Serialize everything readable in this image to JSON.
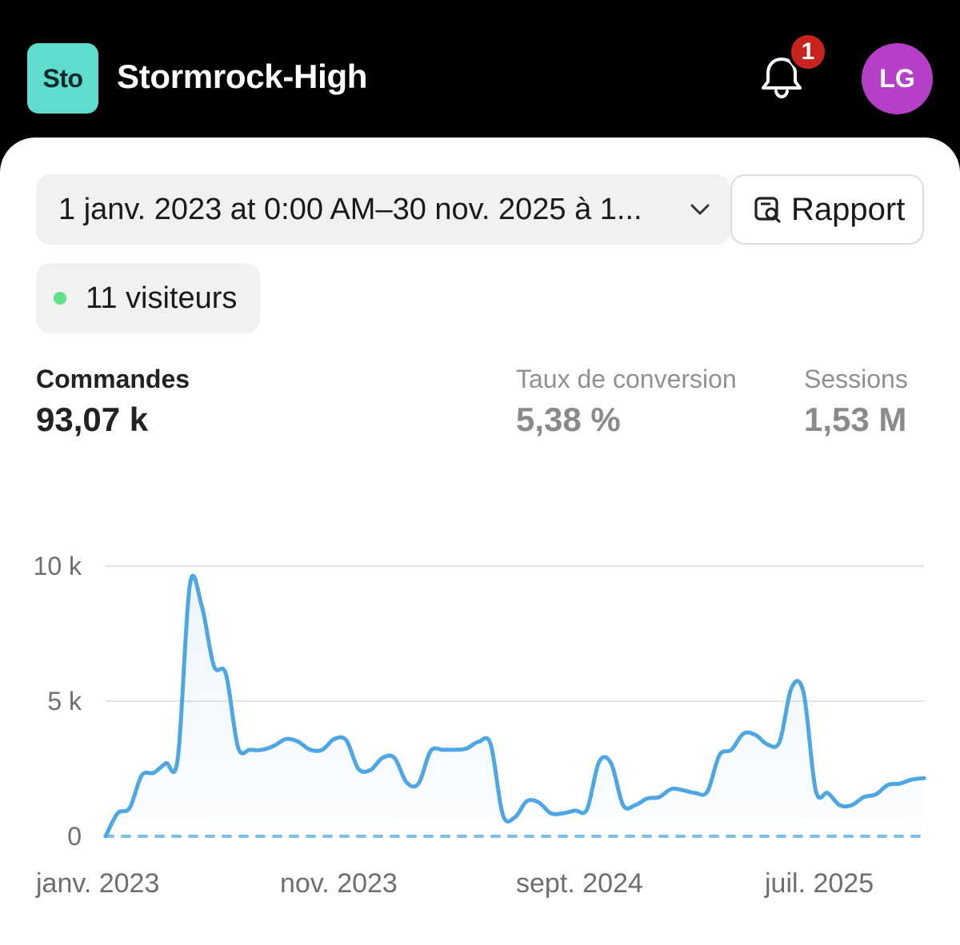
{
  "header": {
    "store_initials": "Sto",
    "store_name": "Stormrock-High",
    "notification_count": "1",
    "user_initials": "LG",
    "colors": {
      "store_logo": "#5fdccd",
      "avatar": "#b63fc8",
      "badge": "#c9231f"
    }
  },
  "filters": {
    "date_range": "1 janv. 2023 at 0:00 AM–30 nov. 2025 à 1...",
    "report_label": "Rapport",
    "live_visitors": "11 visiteurs"
  },
  "metrics": [
    {
      "label": "Commandes",
      "value": "93,07 k",
      "active": true
    },
    {
      "label": "Taux de conversion",
      "value": "5,38 %",
      "active": false
    },
    {
      "label": "Sessions",
      "value": "1,53 M",
      "active": false
    }
  ],
  "chart_data": {
    "type": "line",
    "y_tick_labels": [
      "10 k",
      "5 k",
      "0"
    ],
    "y_ticks": [
      10000,
      5000,
      0
    ],
    "x_tick_labels": [
      "janv. 2023",
      "nov. 2023",
      "sept. 2024",
      "juil. 2025"
    ],
    "ylim": [
      0,
      10000
    ],
    "grid": true,
    "line_color": "#4ea7e3",
    "comparison_line_color": "#7fbfe6",
    "series": [
      {
        "values": [
          0,
          850,
          1050,
          2250,
          2350,
          2700,
          2900,
          9300,
          8500,
          6300,
          6000,
          3300,
          3200,
          3200,
          3350,
          3600,
          3500,
          3200,
          3200,
          3600,
          3550,
          2500,
          2450,
          2900,
          2900,
          2000,
          1950,
          3150,
          3200,
          3200,
          3250,
          3500,
          3400,
          800,
          700,
          1300,
          1250,
          850,
          850,
          950,
          1000,
          2750,
          2700,
          1150,
          1150,
          1400,
          1450,
          1750,
          1700,
          1600,
          1650,
          3000,
          3200,
          3800,
          3750,
          3400,
          3500,
          5500,
          5300,
          1700,
          1600,
          1150,
          1150,
          1450,
          1550,
          1900,
          1950,
          2100,
          2150
        ]
      },
      {
        "values": [
          0,
          0,
          0,
          0,
          0,
          0,
          0,
          0,
          0,
          0,
          0,
          0,
          0,
          0,
          0,
          0,
          0,
          0,
          0,
          0,
          0,
          0,
          0,
          0,
          0,
          0,
          0,
          0,
          0,
          0,
          0,
          0,
          0,
          0,
          0,
          0,
          0,
          0,
          0,
          0,
          0,
          0,
          0,
          0,
          0,
          0,
          0,
          0,
          0,
          0,
          0,
          0,
          0,
          0,
          0,
          0,
          0,
          0,
          0,
          0,
          0,
          0,
          0,
          0,
          0,
          0,
          0,
          0,
          0
        ]
      }
    ]
  }
}
